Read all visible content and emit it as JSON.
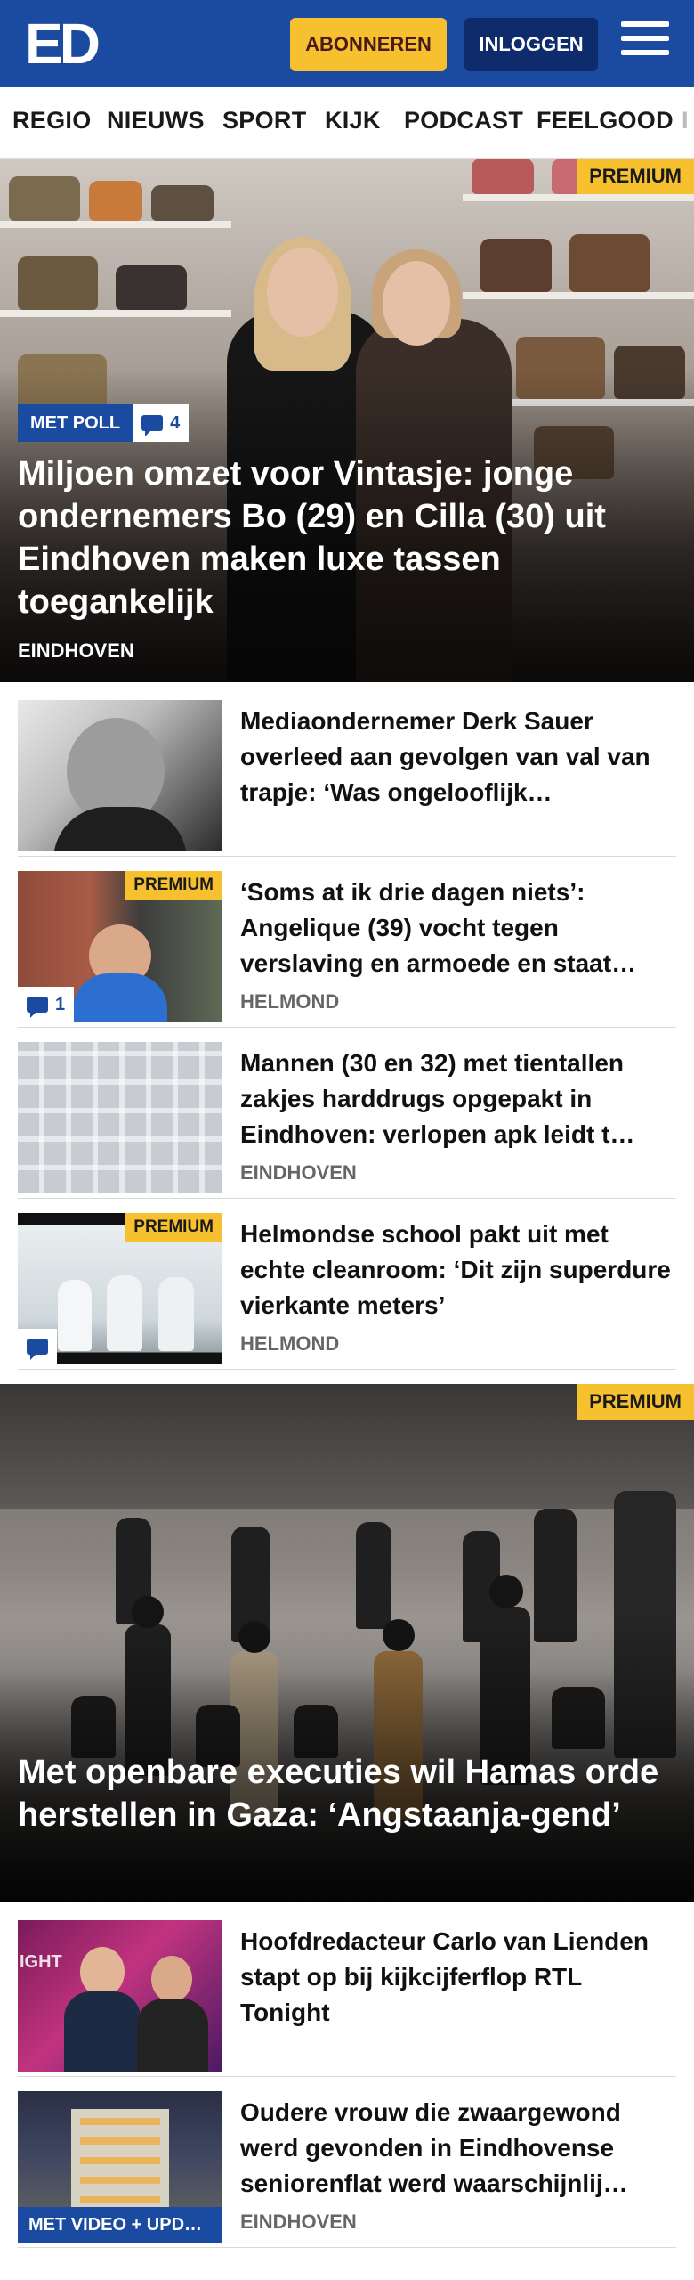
{
  "header": {
    "logo_text": "ED",
    "subscribe_label": "ABONNEREN",
    "login_label": "INLOGGEN",
    "menu_icon": "hamburger-menu-icon"
  },
  "nav": {
    "items": [
      "REGIO",
      "NIEUWS",
      "SPORT",
      "KIJK",
      "PODCAST",
      "FEELGOOD",
      "I"
    ]
  },
  "hero": {
    "badge": "PREMIUM",
    "poll_label": "MET POLL",
    "comment_count": "4",
    "title": "Miljoen omzet voor Vintasje: jonge ondernemers Bo (29) en Cilla (30) uit Eindhoven maken luxe tassen toegankelijk",
    "location": "EINDHOVEN"
  },
  "articles": [
    {
      "title": "Mediaondernemer Derk Sauer overleed aan gevolgen van val van trapje: ‘Was ongelooflijk…",
      "location": "",
      "premium": "",
      "comments": ""
    },
    {
      "title": "‘Soms at ik drie dagen niets’: Angelique (39) vocht tegen verslaving en armoede en staat…",
      "location": "HELMOND",
      "premium": "PREMIUM",
      "comments": "1"
    },
    {
      "title": "Mannen (30 en 32) met tientallen zakjes harddrugs opgepakt in Eindhoven: verlopen apk leidt t…",
      "location": "EINDHOVEN",
      "premium": "",
      "comments": ""
    },
    {
      "title": "Helmondse school pakt uit met echte cleanroom: ‘Dit zijn superdure vierkante meters’",
      "location": "HELMOND",
      "premium": "PREMIUM",
      "comments": ""
    }
  ],
  "hero2": {
    "badge": "PREMIUM",
    "title": "Met openbare executies wil Hamas orde herstellen in Gaza: ‘Angstaanja-gend’"
  },
  "articles2": [
    {
      "title": "Hoofdredacteur Carlo van Lienden stapt op bij kijkcijferflop RTL Tonight",
      "location": "",
      "thumb_text": "IGHT"
    },
    {
      "title": "Oudere vrouw die zwaargewond werd gevonden in Eindhovense seniorenflat werd waarschijnlij…",
      "location": "EINDHOVEN",
      "video_tag": "MET VIDEO + UPD…"
    }
  ],
  "colors": {
    "brand_blue": "#1b4ba1",
    "dark_blue": "#0e2c6b",
    "premium_yellow": "#f6c02e"
  }
}
